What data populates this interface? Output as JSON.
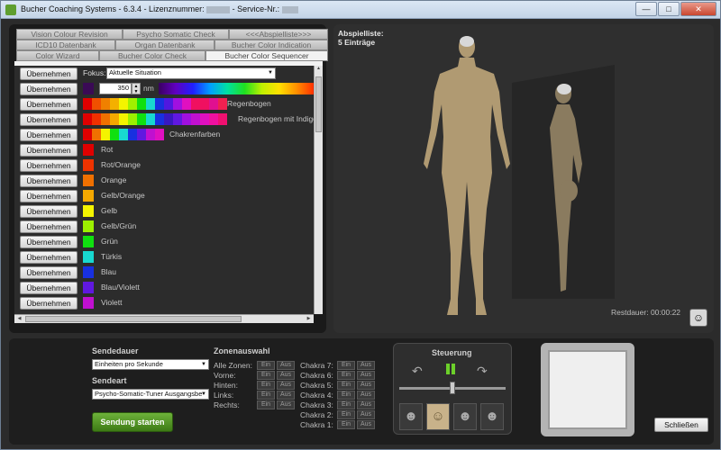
{
  "window": {
    "title_prefix": "Bucher Coaching Systems - 6.3.4 - Lizenznummer:",
    "title_service": "- Service-Nr.:",
    "buttons": [
      "—",
      "□",
      "✕"
    ]
  },
  "tabs": {
    "row1": [
      "Vision Colour Revision",
      "Psycho Somatic Check",
      "<<<Abspielliste>>>"
    ],
    "row2": [
      "ICD10 Datenbank",
      "Organ Datenbank",
      "Bucher Color Indication"
    ],
    "row3": [
      "Color Wizard",
      "Bucher Color Check",
      "Bucher Color Sequencer"
    ]
  },
  "list": {
    "button_label": "Übernehmen",
    "focus_label": "Fokus:",
    "focus_value": "Aktuelle Situation",
    "nm_value": "350",
    "nm_unit": "nm",
    "rows": [
      {
        "label": "Regenbogen"
      },
      {
        "label": "Regenbogen mit Indigo"
      },
      {
        "label": "Chakrenfarben"
      },
      {
        "label": "Rot",
        "color": "#e00000"
      },
      {
        "label": "Rot/Orange",
        "color": "#ee3300"
      },
      {
        "label": "Orange",
        "color": "#f07000"
      },
      {
        "label": "Gelb/Orange",
        "color": "#f4a800"
      },
      {
        "label": "Gelb",
        "color": "#f4f400"
      },
      {
        "label": "Gelb/Grün",
        "color": "#9cf000"
      },
      {
        "label": "Grün",
        "color": "#10e010"
      },
      {
        "label": "Türkis",
        "color": "#18d8d0"
      },
      {
        "label": "Blau",
        "color": "#1830e0"
      },
      {
        "label": "Blau/Violett",
        "color": "#6018e0"
      },
      {
        "label": "Violett",
        "color": "#c010d0"
      }
    ]
  },
  "viewer": {
    "playlist_title": "Abspielliste:",
    "playlist_count": "5 Einträge",
    "remaining": "Restdauer: 00:00:22"
  },
  "bottom": {
    "sendedauer_label": "Sendedauer",
    "sendedauer_value": "Einheiten pro Sekunde",
    "sendeart_label": "Sendeart",
    "sendeart_value": "Psycho-Somatic-Tuner Ausgangsbe",
    "start_button": "Sendung starten",
    "zonen_title": "Zonenauswahl",
    "zones": [
      "Alle Zonen:",
      "Vorne:",
      "Hinten:",
      "Links:",
      "Rechts:"
    ],
    "chakras": [
      "Chakra 7:",
      "Chakra 6:",
      "Chakra 5:",
      "Chakra 4:",
      "Chakra 3:",
      "Chakra 2:",
      "Chakra 1:"
    ],
    "ein": "Ein",
    "aus": "Aus",
    "steuerung_title": "Steuerung",
    "close_button": "Schließen"
  },
  "colors": {
    "accent_green": "#4a8f1c",
    "panel_dark": "#1e1e1e"
  }
}
